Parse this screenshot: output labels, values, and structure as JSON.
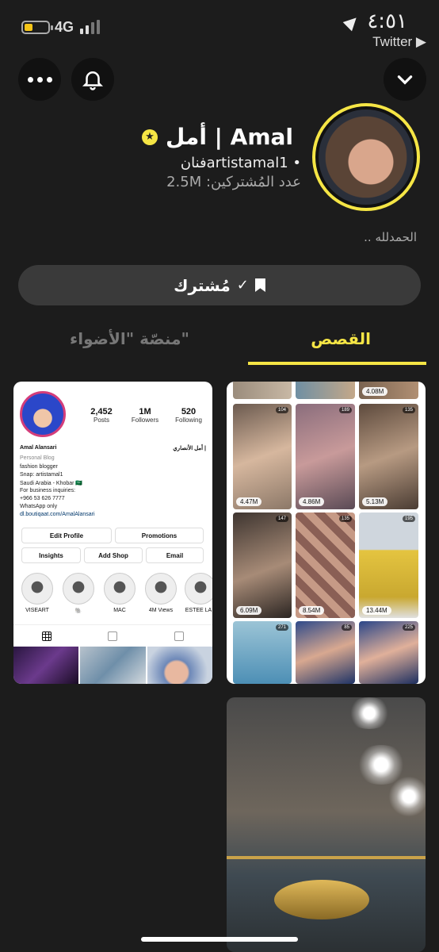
{
  "status_bar": {
    "network": "4G",
    "time": "٤:٥١",
    "back_app": "Twitter ▶",
    "battery_level": 0.25
  },
  "profile": {
    "display_name": "أمل | Amal",
    "handle": "• artistamal1فنان",
    "subscribers": "عدد المُشتركين: 2.5M",
    "bio": "الحمدلله .."
  },
  "actions": {
    "subscribe_label": "مُشترك"
  },
  "tabs": {
    "stories": "القصص",
    "spotlight": "منصّة \"الأضواء\""
  },
  "insta_tile": {
    "posts": "2,452",
    "posts_label": "Posts",
    "followers": "1M",
    "followers_label": "Followers",
    "following": "520",
    "following_label": "Following",
    "name_en": "Amal Alansari",
    "name_ar": "أمل الأنصاري |",
    "category": "Personal Blog",
    "bio_lines": [
      "fashion blogger",
      "Snap: artistamal1",
      "Saudi Arabia - Khobar 🇸🇦",
      "For business inquiries:",
      "+966 53 626 7777",
      "WhatsApp only"
    ],
    "link": "dl.boutiqaat.com/AmalAlansari",
    "buttons": [
      "Edit Profile",
      "Promotions",
      "Insights",
      "Add Shop",
      "Email"
    ],
    "highlights": [
      "VISEART",
      "🐘",
      "MAC",
      "4M Views",
      "ESTÉE LA"
    ]
  },
  "grid_tile": {
    "top_views": "4.08M",
    "cells": [
      {
        "views": "4.47M",
        "badge": "104"
      },
      {
        "views": "4.86M",
        "badge": "189"
      },
      {
        "views": "5.13M",
        "badge": "135"
      },
      {
        "views": "6.09M",
        "badge": "147"
      },
      {
        "views": "8.54M",
        "badge": "135"
      },
      {
        "views": "13.44M",
        "badge": "195"
      },
      {
        "views": "",
        "badge": "271"
      },
      {
        "views": "",
        "badge": "85"
      },
      {
        "views": "",
        "badge": "225"
      }
    ]
  }
}
